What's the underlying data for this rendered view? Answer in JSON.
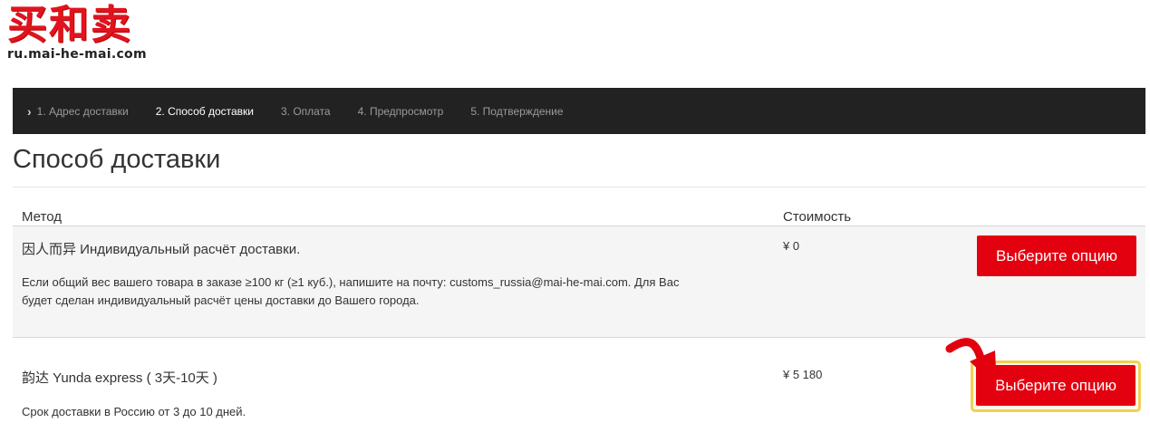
{
  "brand": {
    "logo_text": "买和卖",
    "site_url": "ru.mai-he-mai.com"
  },
  "checkout_steps": [
    {
      "label": "1. Адрес доставки",
      "state": "completed"
    },
    {
      "label": "2. Способ доставки",
      "state": "active"
    },
    {
      "label": "3. Оплата",
      "state": "pending"
    },
    {
      "label": "4. Предпросмотр",
      "state": "pending"
    },
    {
      "label": "5. Подтверждение",
      "state": "pending"
    }
  ],
  "page_title": "Способ доставки",
  "table": {
    "columns": [
      "Метод",
      "Стоимость"
    ],
    "rows": [
      {
        "method": "因人而异 Индивидуальный расчёт доставки.",
        "description_line1": "Если общий вес вашего товара в заказе ≥100 кг (≥1 куб.), напишите на почту: customs_russia@mai-he-mai.com. Для Вас",
        "description_line2": "будет сделан индивидуальный расчёт цены доставки до Вашего города.",
        "price": "¥ 0",
        "button_label": "Выберите опцию"
      },
      {
        "method": "韵达 Yunda express ( 3天-10天 )",
        "description_line1": "Срок доставки в Россию от 3 до 10 дней.",
        "price": "¥ 5 180",
        "button_label": "Выберите опцию",
        "highlighted": true
      }
    ]
  },
  "colors": {
    "brand_red": "#e0141f",
    "button_red": "#e3000f",
    "nav_bg": "#222222",
    "highlight_yellow": "#f2cf55"
  },
  "icons": [
    "chevron-right-icon",
    "pointer-arrow-icon"
  ]
}
